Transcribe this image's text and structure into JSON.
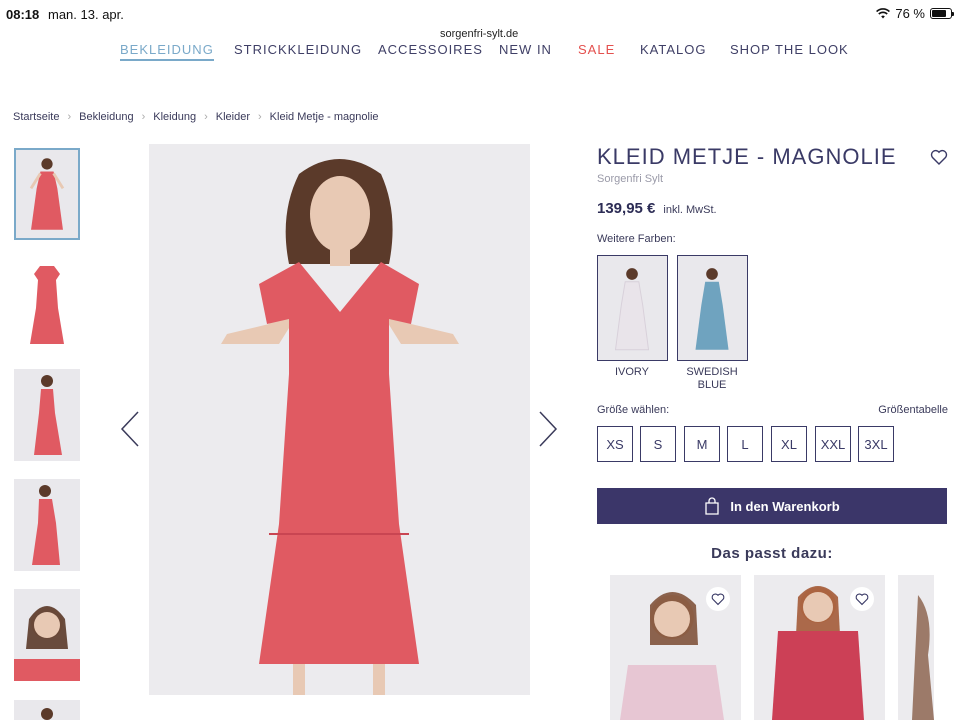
{
  "status_bar": {
    "time": "08:18",
    "date": "man. 13. apr.",
    "url": "sorgenfri-sylt.de",
    "battery_text": "76 %",
    "battery_level": 0.76
  },
  "nav": {
    "items": [
      {
        "label": "BEKLEIDUNG",
        "active": true
      },
      {
        "label": "STRICKKLEIDUNG"
      },
      {
        "label": "ACCESSOIRES"
      },
      {
        "label": "NEW IN"
      },
      {
        "label": "SALE",
        "highlight": true
      },
      {
        "label": "KATALOG"
      },
      {
        "label": "SHOP THE LOOK"
      }
    ]
  },
  "breadcrumb": [
    "Startseite",
    "Bekleidung",
    "Kleidung",
    "Kleider",
    "Kleid Metje - magnolie"
  ],
  "product": {
    "title": "KLEID METJE - MAGNOLIE",
    "brand": "Sorgenfri Sylt",
    "price": "139,95 €",
    "vat_note": "inkl. MwSt.",
    "more_colors_label": "Weitere Farben:",
    "colors": [
      {
        "label": "IVORY",
        "swatch": "#e9e4ea"
      },
      {
        "label": "SWEDISH BLUE",
        "swatch": "#6fa3bf"
      }
    ],
    "size_label": "Größe wählen:",
    "size_chart_label": "Größentabelle",
    "sizes": [
      "XS",
      "S",
      "M",
      "L",
      "XL",
      "XXL",
      "3XL"
    ],
    "cart_label": "In den Warenkorb",
    "dress_color": "#e05a62"
  },
  "recommendations": {
    "title": "Das passt dazu:",
    "items": [
      {
        "color": "#e7c6d3"
      },
      {
        "color": "#cc4056"
      },
      {
        "color": "#d9d9e0"
      }
    ]
  },
  "colors": {
    "accent": "#7aa9c9",
    "primary": "#3b3669",
    "sale": "#e4504e"
  }
}
